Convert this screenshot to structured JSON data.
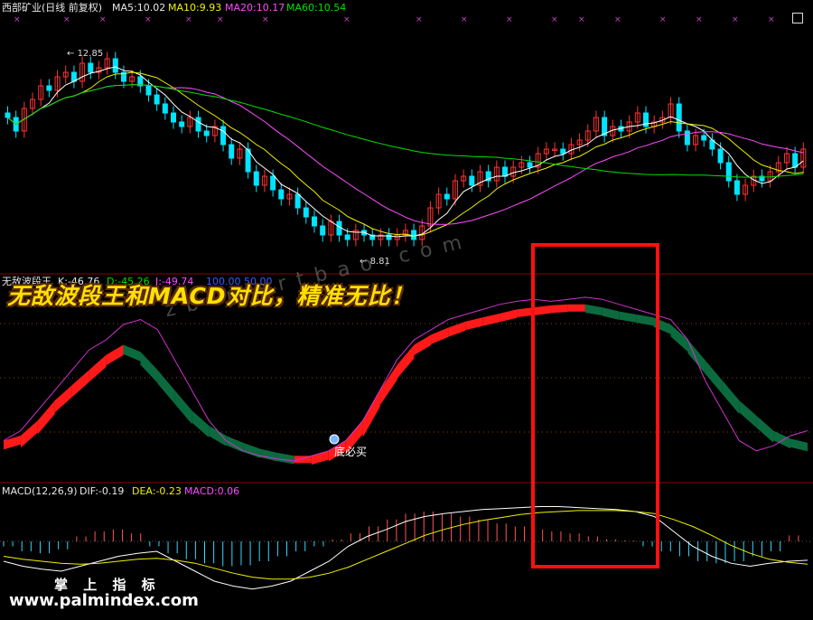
{
  "title": {
    "stock": "西部矿业(日线 前复权)",
    "ma5": "MA5:10.02",
    "ma10": "MA10:9.93",
    "ma20": "MA20:10.17",
    "ma60": "MA60:10.54"
  },
  "price_annotations": {
    "high": "12.85",
    "low": "8.81"
  },
  "indicator": {
    "name": "无敌波段王",
    "k": "K:-46.76",
    "d": "D:-45.26",
    "j": "J:-49.74",
    "extra": "100.00 50.00",
    "buy_label": "底必买"
  },
  "macd": {
    "name": "MACD(12,26,9)",
    "dif": "DIF:-0.19",
    "dea": "DEA:-0.23",
    "macd": "MACD:0.06"
  },
  "overlay": {
    "slogan": "无敌波段王和MACD对比，精准无比！",
    "watermark": "zb-martbao.com",
    "brand": "掌 上 指 标",
    "site": "www.palmindex.com"
  },
  "colors": {
    "up": "#ff3232",
    "down": "#00e4ff",
    "ma5": "#ffffff",
    "ma10": "#f0f000",
    "ma20": "#ff4cff",
    "ma60": "#00e000",
    "band_up": "#ff1a1a",
    "band_down": "#0b6b3f",
    "k_line": "#cc33cc",
    "dif": "#ffffff",
    "dea": "#f0f000",
    "macd_pos": "#ff5555",
    "macd_neg": "#33d6ff"
  },
  "chart_data": [
    {
      "type": "candlestick",
      "title": "西部矿业(日线 前复权)",
      "ylim": [
        8.3,
        13.6
      ],
      "series": [
        {
          "name": "MA5",
          "values": []
        },
        {
          "name": "MA10",
          "values": []
        },
        {
          "name": "MA20",
          "values": []
        },
        {
          "name": "MA60",
          "values": []
        }
      ],
      "close": [
        11.6,
        11.3,
        11.8,
        12.0,
        12.3,
        12.2,
        12.5,
        12.6,
        12.4,
        12.8,
        12.6,
        12.7,
        12.9,
        12.6,
        12.4,
        12.5,
        12.3,
        12.1,
        11.9,
        11.7,
        11.5,
        11.4,
        11.6,
        11.3,
        11.2,
        11.4,
        11.0,
        10.7,
        10.9,
        10.4,
        10.1,
        10.3,
        10.0,
        9.8,
        9.9,
        9.6,
        9.4,
        9.2,
        9.0,
        9.3,
        9.0,
        8.9,
        9.1,
        9.0,
        8.9,
        9.0,
        8.9,
        9.0,
        9.1,
        8.9,
        9.2,
        9.6,
        9.9,
        9.8,
        10.2,
        10.3,
        10.1,
        10.4,
        10.2,
        10.5,
        10.3,
        10.5,
        10.6,
        10.5,
        10.8,
        10.9,
        10.9,
        10.8,
        11.0,
        11.1,
        11.3,
        11.6,
        11.2,
        11.4,
        11.3,
        11.5,
        11.7,
        11.4,
        11.5,
        11.6,
        11.9,
        11.3,
        11.0,
        11.2,
        11.1,
        10.9,
        10.6,
        10.2,
        9.9,
        10.1,
        10.3,
        10.2,
        10.4,
        10.6,
        10.8,
        10.5,
        10.9
      ]
    },
    {
      "type": "area",
      "title": "无敌波段王",
      "ylim": [
        -60,
        110
      ],
      "k_j": [
        -40,
        -30,
        -10,
        10,
        30,
        50,
        60,
        75,
        80,
        70,
        40,
        10,
        -20,
        -40,
        -50,
        -55,
        -58,
        -60,
        -55,
        -50,
        -40,
        -20,
        10,
        40,
        60,
        70,
        80,
        85,
        90,
        95,
        98,
        100,
        98,
        100,
        102,
        100,
        95,
        90,
        85,
        80,
        60,
        20,
        -10,
        -40,
        -50,
        -45,
        -35,
        -30
      ],
      "band": [
        -40,
        -35,
        -20,
        0,
        15,
        30,
        45,
        55,
        48,
        30,
        10,
        -10,
        -25,
        -35,
        -42,
        -48,
        -52,
        -55,
        -55,
        -50,
        -40,
        -20,
        10,
        35,
        55,
        65,
        72,
        78,
        82,
        86,
        90,
        92,
        94,
        95,
        95,
        92,
        88,
        85,
        82,
        75,
        60,
        40,
        20,
        0,
        -15,
        -30,
        -38,
        -42
      ]
    },
    {
      "type": "bar",
      "title": "MACD(12,26,9)",
      "ylim": [
        -0.5,
        0.5
      ],
      "values": [
        -0.05,
        -0.1,
        -0.12,
        -0.08,
        0.05,
        0.1,
        0.12,
        0.08,
        -0.05,
        -0.12,
        -0.18,
        -0.22,
        -0.25,
        -0.24,
        -0.2,
        -0.15,
        -0.1,
        -0.05,
        0.02,
        0.08,
        0.15,
        0.22,
        0.28,
        0.3,
        0.28,
        0.25,
        0.22,
        0.18,
        0.15,
        0.12,
        0.1,
        0.08,
        0.05,
        0.02,
        0.01,
        -0.05,
        -0.1,
        -0.15,
        -0.2,
        -0.22,
        -0.2,
        -0.15,
        -0.1,
        0.06
      ],
      "dif": [
        -0.2,
        -0.25,
        -0.28,
        -0.3,
        -0.25,
        -0.2,
        -0.15,
        -0.12,
        -0.1,
        -0.2,
        -0.3,
        -0.4,
        -0.45,
        -0.48,
        -0.45,
        -0.4,
        -0.3,
        -0.2,
        -0.05,
        0.05,
        0.12,
        0.2,
        0.25,
        0.28,
        0.3,
        0.32,
        0.33,
        0.34,
        0.35,
        0.35,
        0.34,
        0.33,
        0.32,
        0.3,
        0.25,
        0.1,
        -0.05,
        -0.15,
        -0.22,
        -0.25,
        -0.22,
        -0.2,
        -0.19
      ],
      "dea": [
        -0.15,
        -0.18,
        -0.2,
        -0.22,
        -0.23,
        -0.22,
        -0.2,
        -0.18,
        -0.17,
        -0.19,
        -0.22,
        -0.27,
        -0.32,
        -0.36,
        -0.38,
        -0.38,
        -0.36,
        -0.32,
        -0.26,
        -0.18,
        -0.1,
        -0.02,
        0.06,
        0.12,
        0.17,
        0.21,
        0.24,
        0.27,
        0.29,
        0.3,
        0.31,
        0.31,
        0.31,
        0.3,
        0.28,
        0.22,
        0.15,
        0.06,
        -0.04,
        -0.12,
        -0.18,
        -0.21,
        -0.23
      ]
    }
  ]
}
